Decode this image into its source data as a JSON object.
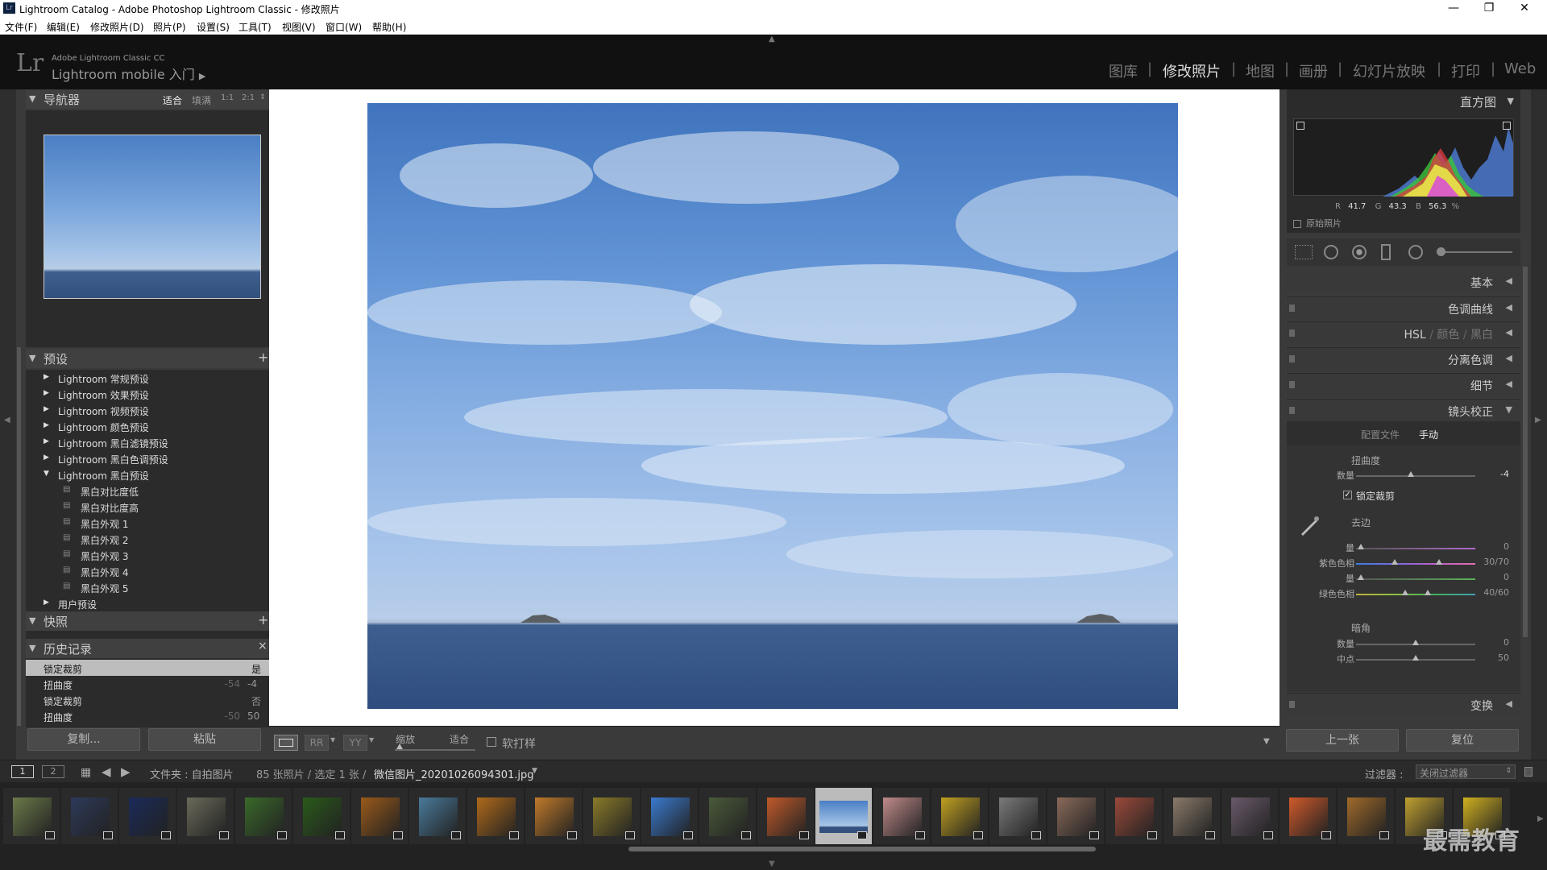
{
  "window": {
    "app_icon": "Lr",
    "title": "Lightroom Catalog - Adobe Photoshop Lightroom Classic - 修改照片",
    "minimize_icon": "minimize-icon",
    "maximize_icon": "restore-icon",
    "close_icon": "close-icon"
  },
  "menu": [
    "文件(F)",
    "编辑(E)",
    "修改照片(D)",
    "照片(P)",
    "设置(S)",
    "工具(T)",
    "视图(V)",
    "窗口(W)",
    "帮助(H)"
  ],
  "identity": {
    "logo": "Lr",
    "product": "Adobe Lightroom Classic CC",
    "mobile": "Lightroom mobile 入门",
    "modules": [
      "图库",
      "修改照片",
      "地图",
      "画册",
      "幻灯片放映",
      "打印",
      "Web"
    ],
    "active_module": "修改照片"
  },
  "navigator": {
    "title": "导航器",
    "zoom_options": [
      "适合",
      "填满",
      "1:1",
      "2:1"
    ],
    "active_zoom": "适合"
  },
  "presets": {
    "title": "预设",
    "add": "+",
    "groups": [
      "Lightroom 常规预设",
      "Lightroom 效果预设",
      "Lightroom 视频预设",
      "Lightroom 颜色预设",
      "Lightroom 黑白滤镜预设",
      "Lightroom 黑白色调预设",
      "Lightroom 黑白预设"
    ],
    "bw_items": [
      "黑白对比度低",
      "黑白对比度高",
      "黑白外观 1",
      "黑白外观 2",
      "黑白外观 3",
      "黑白外观 4",
      "黑白外观 5"
    ],
    "user_group": "用户预设"
  },
  "snapshots": {
    "title": "快照",
    "add": "+"
  },
  "history": {
    "title": "历史记录",
    "clear": "×",
    "rows": [
      {
        "name": "锁定裁剪",
        "a": "",
        "b": "是"
      },
      {
        "name": "扭曲度",
        "a": "-54",
        "b": "-4"
      },
      {
        "name": "锁定裁剪",
        "a": "",
        "b": "否"
      },
      {
        "name": "扭曲度",
        "a": "-50",
        "b": "50"
      }
    ]
  },
  "left_buttons": {
    "copy": "复制...",
    "paste": "粘贴"
  },
  "toolbar": {
    "zoom_label": "缩放",
    "fit_label": "适合",
    "softproof_label": "软打样"
  },
  "histogram": {
    "title": "直方图",
    "r_label": "R",
    "r": "41.7",
    "g_label": "G",
    "g": "43.3",
    "b_label": "B",
    "b": "56.3",
    "pct": "%",
    "original_label": "原始照片"
  },
  "right_sections": {
    "basic": "基本",
    "tone_curve": "色调曲线",
    "hsl": "HSL",
    "color": "颜色",
    "bw": "黑白",
    "split": "分离色调",
    "detail": "细节",
    "lens": "镜头校正",
    "transform": "变换"
  },
  "lens": {
    "tabs": [
      "配置文件",
      "手动"
    ],
    "active_tab": "手动",
    "distortion_title": "扭曲度",
    "amount_label": "数量",
    "amount_value": "-4",
    "constrain_label": "锁定裁剪",
    "constrain_checked": true,
    "defringe_title": "去边",
    "purple_amount_label": "量",
    "purple_amount_value": "0",
    "purple_hue_label": "紫色色相",
    "purple_hue_value": "30/70",
    "green_amount_label": "量",
    "green_amount_value": "0",
    "green_hue_label": "绿色色相",
    "green_hue_value": "40/60",
    "vignette_title": "暗角",
    "vig_amount_label": "数量",
    "vig_amount_value": "0",
    "vig_mid_label": "中点",
    "vig_mid_value": "50"
  },
  "right_buttons": {
    "prev": "上一张",
    "reset": "复位"
  },
  "filmstrip_bar": {
    "page1": "1",
    "page2": "2",
    "source": "文件夹 : 自拍图片",
    "count": "85 张照片 / 选定 1 张 /",
    "filename": "微信图片_20201026094301.jpg",
    "filter_label": "过滤器 :",
    "filter_value": "关闭过滤器"
  },
  "watermark": "最需教育",
  "colors": {
    "panel": "#3a3a3a",
    "dark": "#111111",
    "accent": "#dddddd"
  }
}
